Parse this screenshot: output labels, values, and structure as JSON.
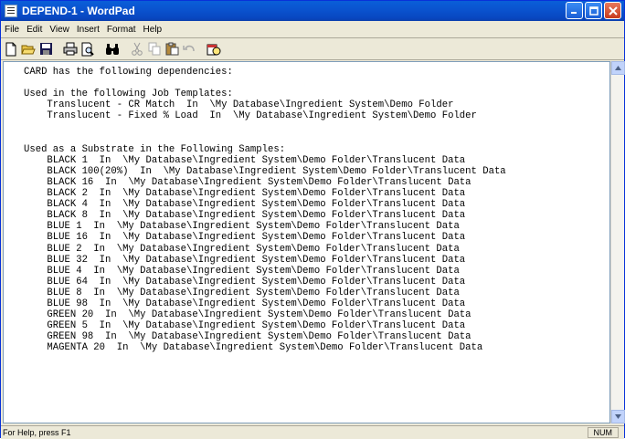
{
  "window": {
    "title": "DEPEND-1 - WordPad"
  },
  "menu": [
    "File",
    "Edit",
    "View",
    "Insert",
    "Format",
    "Help"
  ],
  "toolbar": {
    "icons": [
      "new-icon",
      "open-icon",
      "save-icon",
      "print-icon",
      "print-preview-icon",
      "find-icon",
      "cut-icon",
      "copy-icon",
      "paste-icon",
      "undo-icon",
      "date-time-icon"
    ]
  },
  "document": {
    "lines": [
      "CARD has the following dependencies:",
      "",
      "Used in the following Job Templates:",
      "    Translucent - CR Match  In  \\My Database\\Ingredient System\\Demo Folder",
      "    Translucent - Fixed % Load  In  \\My Database\\Ingredient System\\Demo Folder",
      "",
      "",
      "Used as a Substrate in the Following Samples:",
      "    BLACK 1  In  \\My Database\\Ingredient System\\Demo Folder\\Translucent Data",
      "    BLACK 100(20%)  In  \\My Database\\Ingredient System\\Demo Folder\\Translucent Data",
      "    BLACK 16  In  \\My Database\\Ingredient System\\Demo Folder\\Translucent Data",
      "    BLACK 2  In  \\My Database\\Ingredient System\\Demo Folder\\Translucent Data",
      "    BLACK 4  In  \\My Database\\Ingredient System\\Demo Folder\\Translucent Data",
      "    BLACK 8  In  \\My Database\\Ingredient System\\Demo Folder\\Translucent Data",
      "    BLUE 1  In  \\My Database\\Ingredient System\\Demo Folder\\Translucent Data",
      "    BLUE 16  In  \\My Database\\Ingredient System\\Demo Folder\\Translucent Data",
      "    BLUE 2  In  \\My Database\\Ingredient System\\Demo Folder\\Translucent Data",
      "    BLUE 32  In  \\My Database\\Ingredient System\\Demo Folder\\Translucent Data",
      "    BLUE 4  In  \\My Database\\Ingredient System\\Demo Folder\\Translucent Data",
      "    BLUE 64  In  \\My Database\\Ingredient System\\Demo Folder\\Translucent Data",
      "    BLUE 8  In  \\My Database\\Ingredient System\\Demo Folder\\Translucent Data",
      "    BLUE 98  In  \\My Database\\Ingredient System\\Demo Folder\\Translucent Data",
      "    GREEN 20  In  \\My Database\\Ingredient System\\Demo Folder\\Translucent Data",
      "    GREEN 5  In  \\My Database\\Ingredient System\\Demo Folder\\Translucent Data",
      "    GREEN 98  In  \\My Database\\Ingredient System\\Demo Folder\\Translucent Data",
      "    MAGENTA 20  In  \\My Database\\Ingredient System\\Demo Folder\\Translucent Data"
    ]
  },
  "status": {
    "text": "For Help, press F1",
    "num": "NUM"
  },
  "colors": {
    "titlebar": "#0a54d0",
    "chrome": "#ece9d8",
    "close": "#c73b1c"
  }
}
